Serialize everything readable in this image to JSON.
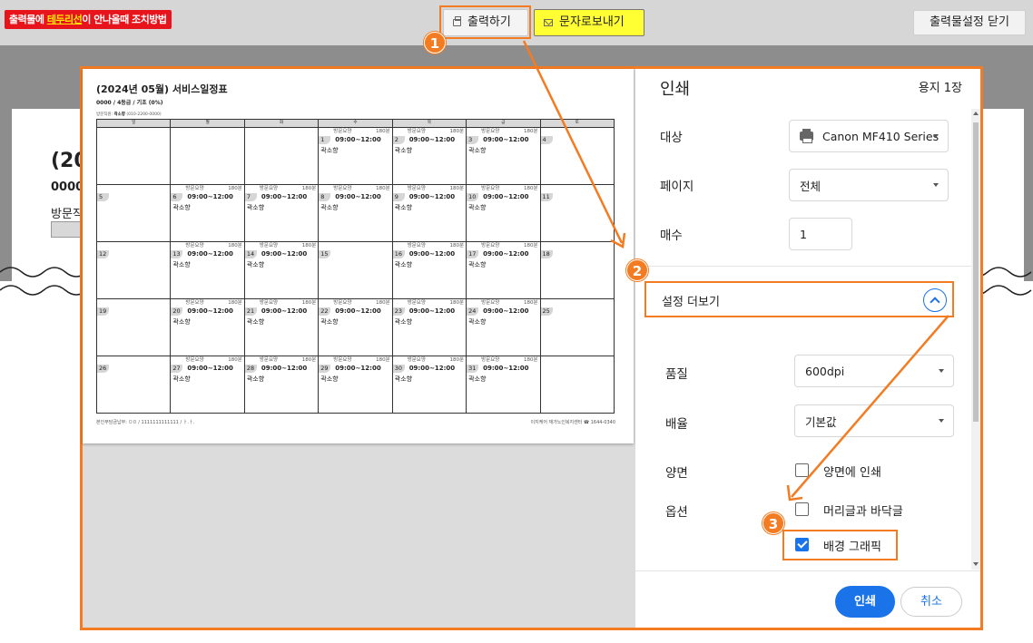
{
  "topbar": {
    "warning_prefix": "출력물에 ",
    "warning_highlight": "테두리선",
    "warning_suffix": "이 안나올때 조치방법",
    "print_button": "출력하기",
    "sms_button": "문자로보내기",
    "close_button": "출력물설정 닫기"
  },
  "background_doc": {
    "title": "(20",
    "subtitle": "0000",
    "visit_label": "방문직"
  },
  "preview": {
    "title": "(2024년 05월) 서비스일정표",
    "subtitle": "0000 / 4등급 / 기초 (0%)",
    "staff_label": "방문직원: ",
    "staff_name": "곽소향",
    "staff_phone": " (010-2200-0000)",
    "weekdays": [
      "일",
      "월",
      "화",
      "수",
      "목",
      "금",
      "토"
    ],
    "weeks": [
      [
        {
          "day": ""
        },
        {
          "day": ""
        },
        {
          "day": ""
        },
        {
          "day": "1",
          "service": "방문요양",
          "mins": "180분",
          "time": "09:00~12:00",
          "worker": "곽소향"
        },
        {
          "day": "2",
          "service": "방문요양",
          "mins": "180분",
          "time": "09:00~12:00",
          "worker": "곽소향"
        },
        {
          "day": "3",
          "service": "방문요양",
          "mins": "180분",
          "time": "09:00~12:00",
          "worker": "곽소향"
        },
        {
          "day": "4"
        }
      ],
      [
        {
          "day": "5"
        },
        {
          "day": "6",
          "service": "방문요양",
          "mins": "180분",
          "time": "09:00~12:00",
          "worker": "곽소향"
        },
        {
          "day": "7",
          "service": "방문요양",
          "mins": "180분",
          "time": "09:00~12:00",
          "worker": "곽소향"
        },
        {
          "day": "8",
          "service": "방문요양",
          "mins": "180분",
          "time": "09:00~12:00",
          "worker": "곽소향"
        },
        {
          "day": "9",
          "service": "방문요양",
          "mins": "180분",
          "time": "09:00~12:00",
          "worker": "곽소향"
        },
        {
          "day": "10",
          "service": "방문요양",
          "mins": "180분",
          "time": "09:00~12:00",
          "worker": "곽소향"
        },
        {
          "day": "11"
        }
      ],
      [
        {
          "day": "12"
        },
        {
          "day": "13",
          "service": "방문요양",
          "mins": "180분",
          "time": "09:00~12:00",
          "worker": "곽소향"
        },
        {
          "day": "14",
          "service": "방문요양",
          "mins": "180분",
          "time": "09:00~12:00",
          "worker": "곽소향"
        },
        {
          "day": "15"
        },
        {
          "day": "16",
          "service": "방문요양",
          "mins": "180분",
          "time": "09:00~12:00",
          "worker": "곽소향"
        },
        {
          "day": "17",
          "service": "방문요양",
          "mins": "180분",
          "time": "09:00~12:00",
          "worker": "곽소향"
        },
        {
          "day": "18"
        }
      ],
      [
        {
          "day": "19"
        },
        {
          "day": "20",
          "service": "방문요양",
          "mins": "180분",
          "time": "09:00~12:00",
          "worker": "곽소향"
        },
        {
          "day": "21",
          "service": "방문요양",
          "mins": "180분",
          "time": "09:00~12:00",
          "worker": "곽소향"
        },
        {
          "day": "22",
          "service": "방문요양",
          "mins": "180분",
          "time": "09:00~12:00",
          "worker": "곽소향"
        },
        {
          "day": "23",
          "service": "방문요양",
          "mins": "180분",
          "time": "09:00~12:00",
          "worker": "곽소향"
        },
        {
          "day": "24",
          "service": "방문요양",
          "mins": "180분",
          "time": "09:00~12:00",
          "worker": "곽소향"
        },
        {
          "day": "25"
        }
      ],
      [
        {
          "day": "26"
        },
        {
          "day": "27",
          "service": "방문요양",
          "mins": "180분",
          "time": "09:00~12:00",
          "worker": "곽소향"
        },
        {
          "day": "28",
          "service": "방문요양",
          "mins": "180분",
          "time": "09:00~12:00",
          "worker": "곽소향"
        },
        {
          "day": "29",
          "service": "방문요양",
          "mins": "180분",
          "time": "09:00~12:00",
          "worker": "곽소향"
        },
        {
          "day": "30",
          "service": "방문요양",
          "mins": "180분",
          "time": "09:00~12:00",
          "worker": "곽소향"
        },
        {
          "day": "31",
          "service": "방문요양",
          "mins": "180분",
          "time": "09:00~12:00",
          "worker": "곽소향"
        },
        {
          "day": ""
        }
      ]
    ],
    "footer_left": "본인부담금납부: ㅁㅁ / 1111111111111 / ㅏ.ㅏ.",
    "footer_right": "이지케어 재가노인복지센터 ☎ 1644-0340"
  },
  "dialog": {
    "title": "인쇄",
    "pages_count": "용지 1장",
    "destination_label": "대상",
    "destination_value": "Canon MF410 Series",
    "pages_label": "페이지",
    "pages_value": "전체",
    "copies_label": "매수",
    "copies_value": "1",
    "more_settings_label": "설정 더보기",
    "quality_label": "품질",
    "quality_value": "600dpi",
    "scale_label": "배율",
    "scale_value": "기본값",
    "duplex_label": "양면",
    "duplex_option": "양면에 인쇄",
    "options_label": "옵션",
    "header_footer_option": "머리글과 바닥글",
    "background_graphics_option": "배경 그래픽",
    "print_button": "인쇄",
    "cancel_button": "취소"
  },
  "annotations": {
    "step1": "1",
    "step2": "2",
    "step3": "3",
    "accent_color": "#f37b21"
  }
}
